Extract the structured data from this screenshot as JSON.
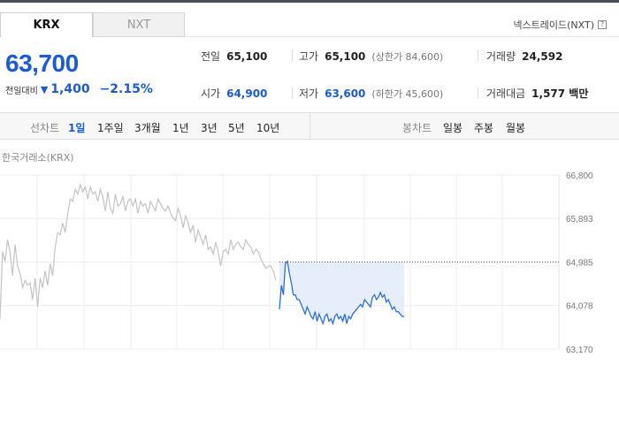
{
  "tabs": [
    {
      "label": "KRX",
      "active": true
    },
    {
      "label": "NXT",
      "active": false
    }
  ],
  "nxt_trade_label": "넥스트레이드(NXT)",
  "help_glyph": "?",
  "quote": {
    "price": "63,700",
    "change_label": "전일대비",
    "change_amount": "1,400",
    "change_percent": "−2.15%",
    "direction": "down"
  },
  "stats": {
    "prev_close": {
      "label": "전일",
      "value": "65,100"
    },
    "high": {
      "label": "고가",
      "value": "65,100",
      "sub": "(상한가 84,600)"
    },
    "volume": {
      "label": "거래량",
      "value": "24,592"
    },
    "open": {
      "label": "시가",
      "value": "64,900"
    },
    "low": {
      "label": "저가",
      "value": "63,600",
      "sub": "(하한가 45,600)"
    },
    "amount": {
      "label": "거래대금",
      "value": "1,577 백만"
    }
  },
  "period_bar": {
    "line_chart_label": "선차트",
    "line_periods": [
      "1일",
      "1주일",
      "3개월",
      "1년",
      "3년",
      "5년",
      "10년"
    ],
    "active_period": "1일",
    "candle_chart_label": "봉차트",
    "candle_periods": [
      "일봉",
      "주봉",
      "월봉"
    ]
  },
  "exchange_label": "한국거래소(KRX)",
  "colors": {
    "down": "#1a5bd6",
    "chart_line_gray": "#c3c3c3",
    "chart_line_blue": "#2b6fdc",
    "chart_fill": "#e6eefb"
  },
  "chart_data": {
    "type": "line",
    "ylim": [
      63170,
      66800
    ],
    "yticks": [
      "66,800",
      "65,893",
      "64,985",
      "64,078",
      "63,170"
    ],
    "reference_value": 64985,
    "series": [
      {
        "color": "#c3c3c3",
        "values": [
          63800,
          65200,
          65000,
          65450,
          65200,
          64700,
          65350,
          64900,
          64750,
          64450,
          64600,
          64500,
          64550,
          64200,
          64650,
          64050,
          64650,
          64450,
          64800,
          64500,
          64950,
          64700,
          65300,
          65600,
          65550,
          65800,
          65600,
          66000,
          66300,
          66250,
          66500,
          66400,
          66600,
          66450,
          66550,
          66300,
          66550,
          66400,
          66450,
          66250,
          66500,
          66350,
          66050,
          66450,
          66100,
          66000,
          66400,
          66150,
          66200,
          66350,
          66050,
          66250,
          66300,
          66150,
          66300,
          66000,
          66250,
          66150,
          66200,
          66000,
          66250,
          66150,
          66050,
          66300,
          66200,
          66100,
          66050,
          66150,
          66000,
          65900,
          65850,
          66100,
          65950,
          65700,
          65950,
          65800,
          65600,
          65750,
          65400,
          65650,
          65500,
          65350,
          65550,
          65250,
          65300,
          65150,
          65400,
          65200,
          64900,
          65200,
          65250,
          65150,
          65450,
          65250,
          65350,
          65400,
          65300,
          65250,
          65450,
          65350,
          65300,
          65150,
          65250,
          65200,
          65050,
          64950,
          64850,
          64900,
          64900,
          64800,
          64600
        ]
      },
      {
        "color": "#2b6fdc",
        "values": [
          64000,
          64500,
          64300,
          64950,
          65000,
          64750,
          64550,
          64300,
          64300,
          64200,
          64200,
          64100,
          64000,
          63900,
          64050,
          63950,
          63850,
          63800,
          63950,
          63750,
          63900,
          63800,
          63700,
          63850,
          63900,
          63750,
          63800,
          63700,
          63850,
          63900,
          63800,
          63850,
          63750,
          63900,
          63700,
          63850,
          63800,
          63900,
          63950,
          64000,
          64050,
          64100,
          64050,
          64200,
          64150,
          64100,
          64050,
          64250,
          64300,
          64200,
          64250,
          64350,
          64250,
          64300,
          64150,
          64200,
          64100,
          64000,
          64050,
          63950,
          63950,
          63900,
          63850,
          63850
        ]
      }
    ]
  }
}
